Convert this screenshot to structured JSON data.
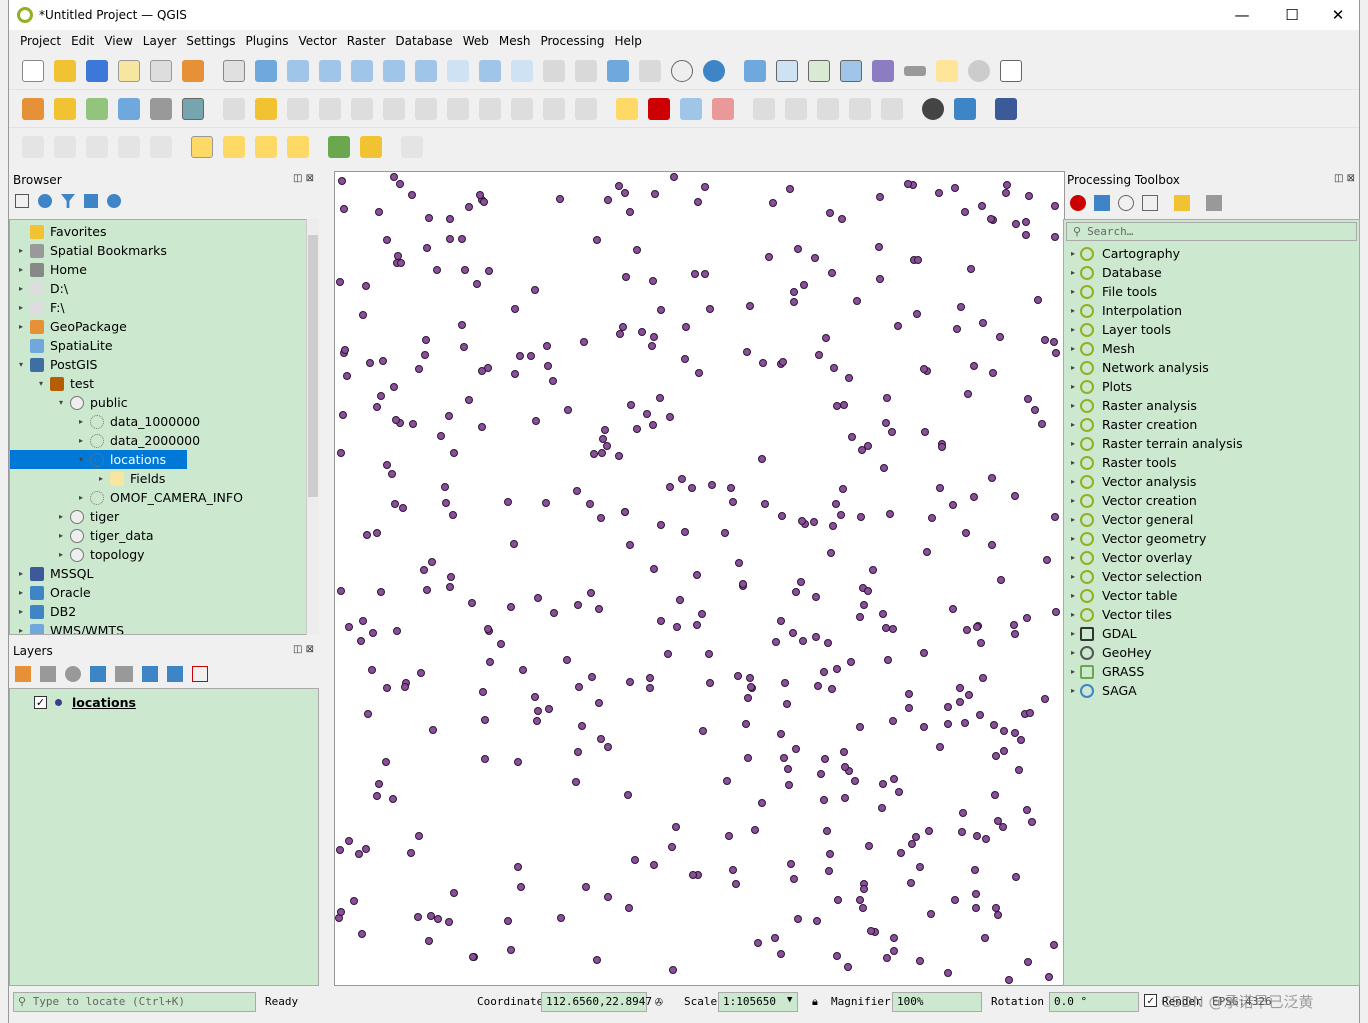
{
  "window": {
    "title": "*Untitled Project — QGIS",
    "minimize": "—",
    "maximize": "☐",
    "close": "✕"
  },
  "menu": [
    "Project",
    "Edit",
    "View",
    "Layer",
    "Settings",
    "Plugins",
    "Vector",
    "Raster",
    "Database",
    "Web",
    "Mesh",
    "Processing",
    "Help"
  ],
  "browser": {
    "title": "Browser",
    "items": [
      {
        "label": "Favorites",
        "icon": "star-icon"
      },
      {
        "label": "Spatial Bookmarks",
        "icon": "bookmark-icon"
      },
      {
        "label": "Home",
        "icon": "home-icon"
      },
      {
        "label": "D:\\",
        "icon": "folder-icon"
      },
      {
        "label": "F:\\",
        "icon": "folder-icon"
      },
      {
        "label": "GeoPackage",
        "icon": "geopackage-icon"
      },
      {
        "label": "SpatiaLite",
        "icon": "feather-icon"
      },
      {
        "label": "PostGIS",
        "icon": "elephant-icon"
      },
      {
        "label": "test",
        "icon": "connection-icon"
      },
      {
        "label": "public",
        "icon": "schema-icon"
      },
      {
        "label": "data_1000000",
        "icon": "point-layer-icon"
      },
      {
        "label": "data_2000000",
        "icon": "point-layer-icon"
      },
      {
        "label": "locations",
        "icon": "point-layer-icon"
      },
      {
        "label": "Fields",
        "icon": "fields-icon"
      },
      {
        "label": "OMOF_CAMERA_INFO",
        "icon": "point-layer-icon"
      },
      {
        "label": "tiger",
        "icon": "schema-icon"
      },
      {
        "label": "tiger_data",
        "icon": "schema-icon"
      },
      {
        "label": "topology",
        "icon": "schema-icon"
      },
      {
        "label": "MSSQL",
        "icon": "mssql-icon"
      },
      {
        "label": "Oracle",
        "icon": "oracle-icon"
      },
      {
        "label": "DB2",
        "icon": "db2-icon"
      },
      {
        "label": "WMS/WMTS",
        "icon": "globe-icon"
      }
    ]
  },
  "layers": {
    "title": "Layers",
    "items": [
      {
        "label": "locations",
        "checked": true
      }
    ]
  },
  "toolbox": {
    "title": "Processing Toolbox",
    "search_placeholder": "Search…",
    "items": [
      "Cartography",
      "Database",
      "File tools",
      "Interpolation",
      "Layer tools",
      "Mesh",
      "Network analysis",
      "Plots",
      "Raster analysis",
      "Raster creation",
      "Raster terrain analysis",
      "Raster tools",
      "Vector analysis",
      "Vector creation",
      "Vector general",
      "Vector geometry",
      "Vector overlay",
      "Vector selection",
      "Vector table",
      "Vector tiles",
      "GDAL",
      "GeoHey",
      "GRASS",
      "SAGA"
    ]
  },
  "status": {
    "locate_placeholder": "Type to locate (Ctrl+K)",
    "ready": "Ready",
    "coordinate_label": "Coordinate",
    "coordinate": "112.6560,22.8947",
    "scale_label": "Scale",
    "scale": "1:105650",
    "magnifier_label": "Magnifier",
    "magnifier": "100%",
    "rotation_label": "Rotation",
    "rotation": "0.0 °",
    "render_label": "Render",
    "crs": "EPSG:4326",
    "watermark": "CSDN @承诺早已泛黄"
  },
  "colors": {
    "panel_green": "#cce8cf",
    "selection": "#0078d7",
    "point_fill": "#8a4f99"
  }
}
